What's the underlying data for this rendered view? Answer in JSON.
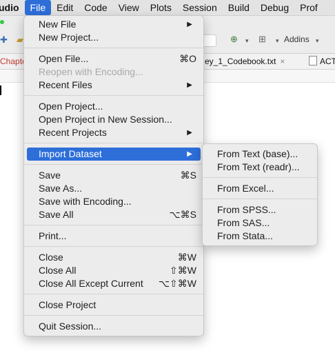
{
  "menubar": {
    "app": "udio",
    "items": [
      "File",
      "Edit",
      "Code",
      "View",
      "Plots",
      "Session",
      "Build",
      "Debug",
      "Prof"
    ]
  },
  "toolbar": {
    "addins_label": "Addins"
  },
  "tabs": {
    "red_tab": "Chapte",
    "codebook_tab": "ey_1_Codebook.txt",
    "act_tab": "ACT_df"
  },
  "file_menu": {
    "new_file": "New File",
    "new_project": "New Project...",
    "open_file": "Open File...",
    "open_file_sc": "⌘O",
    "reopen_encoding": "Reopen with Encoding...",
    "recent_files": "Recent Files",
    "open_project": "Open Project...",
    "open_project_new_session": "Open Project in New Session...",
    "recent_projects": "Recent Projects",
    "import_dataset": "Import Dataset",
    "save": "Save",
    "save_sc": "⌘S",
    "save_as": "Save As...",
    "save_with_encoding": "Save with Encoding...",
    "save_all": "Save All",
    "save_all_sc": "⌥⌘S",
    "print": "Print...",
    "close": "Close",
    "close_sc": "⌘W",
    "close_all": "Close All",
    "close_all_sc": "⇧⌘W",
    "close_all_except": "Close All Except Current",
    "close_all_except_sc": "⌥⇧⌘W",
    "close_project": "Close Project",
    "quit_session": "Quit Session..."
  },
  "import_menu": {
    "from_text_base": "From Text (base)...",
    "from_text_readr": "From Text (readr)...",
    "from_excel": "From Excel...",
    "from_spss": "From SPSS...",
    "from_sas": "From SAS...",
    "from_stata": "From Stata..."
  },
  "colors": {
    "highlight": "#2d6ed8",
    "menu_bg": "#ececec",
    "disabled": "#a9a9a9"
  }
}
